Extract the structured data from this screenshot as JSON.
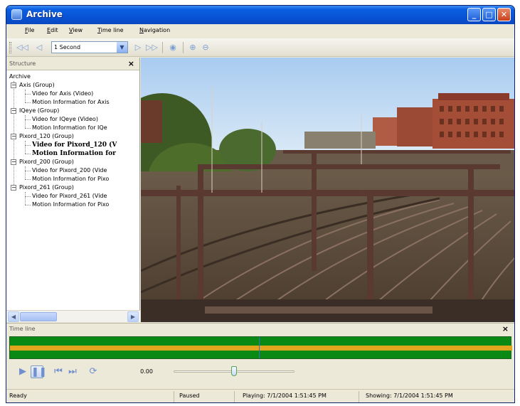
{
  "window": {
    "title": "Archive"
  },
  "menu": {
    "items": [
      {
        "label": "File",
        "ul": "F",
        "rest": "ile"
      },
      {
        "label": "Edit",
        "ul": "E",
        "rest": "dit"
      },
      {
        "label": "View",
        "ul": "V",
        "rest": "iew"
      },
      {
        "label": "Time line",
        "ul": "T",
        "rest": "ime line"
      },
      {
        "label": "Navigation",
        "ul": "N",
        "rest": "avigation"
      }
    ]
  },
  "toolbar": {
    "step_value": "1 Second",
    "icons": [
      "step-back-far-icon",
      "step-back-icon",
      "step-forward-icon",
      "step-forward-far-icon",
      "camera-icon",
      "zoom-in-icon",
      "zoom-out-icon"
    ]
  },
  "structure": {
    "title": "Structure",
    "root": "Archive",
    "groups": [
      {
        "label": "Axis (Group)",
        "children": [
          {
            "label": "Video for Axis (Video)",
            "bold": false
          },
          {
            "label": "Motion Information for Axis",
            "bold": false
          }
        ]
      },
      {
        "label": "IQeye (Group)",
        "children": [
          {
            "label": "Video for IQeye (Video)",
            "bold": false
          },
          {
            "label": "Motion Information for IQe",
            "bold": false
          }
        ]
      },
      {
        "label": "Pixord_120 (Group)",
        "children": [
          {
            "label": "Video for Pixord_120 (V",
            "bold": true
          },
          {
            "label": "Motion Information for",
            "bold": true
          }
        ]
      },
      {
        "label": "Pixord_200 (Group)",
        "children": [
          {
            "label": "Video for Pixord_200 (Vide",
            "bold": false
          },
          {
            "label": "Motion Information for Pixo",
            "bold": false
          }
        ]
      },
      {
        "label": "Pixord_261 (Group)",
        "children": [
          {
            "label": "Video for Pixord_261 (Vide",
            "bold": false
          },
          {
            "label": "Motion Information for Pixo",
            "bold": false
          }
        ]
      }
    ]
  },
  "timeline": {
    "title": "Time line"
  },
  "player": {
    "time": "0.00",
    "position": 0.5
  },
  "status": {
    "state": "Ready",
    "mode": "Paused",
    "playing": "Playing: 7/1/2004 1:51:45 PM",
    "showing": "Showing: 7/1/2004 1:51:45 PM"
  },
  "colors": {
    "titlebar": "#0853d6",
    "timeline_green": "#0a8a14",
    "timeline_orange": "#e1a61e"
  }
}
